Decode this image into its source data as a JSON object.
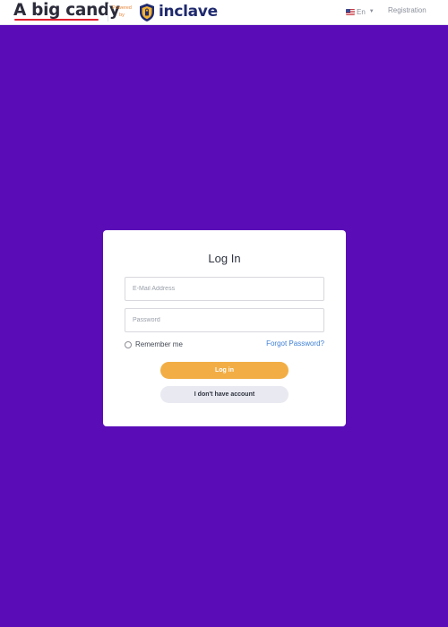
{
  "header": {
    "brand": "A big candy",
    "powered_by": "Powered by",
    "partner": "inclave",
    "language": "En",
    "registration": "Registration"
  },
  "login": {
    "title": "Log In",
    "email_placeholder": "E-Mail Address",
    "password_placeholder": "Password",
    "remember_label": "Remember me",
    "forgot_label": "Forgot Password?",
    "login_button": "Log in",
    "no_account_button": "I don't have account"
  },
  "colors": {
    "background": "#5a0db7",
    "login_button": "#f2ae45",
    "link": "#3d7fd6",
    "brand_underline": "#e0202f"
  }
}
